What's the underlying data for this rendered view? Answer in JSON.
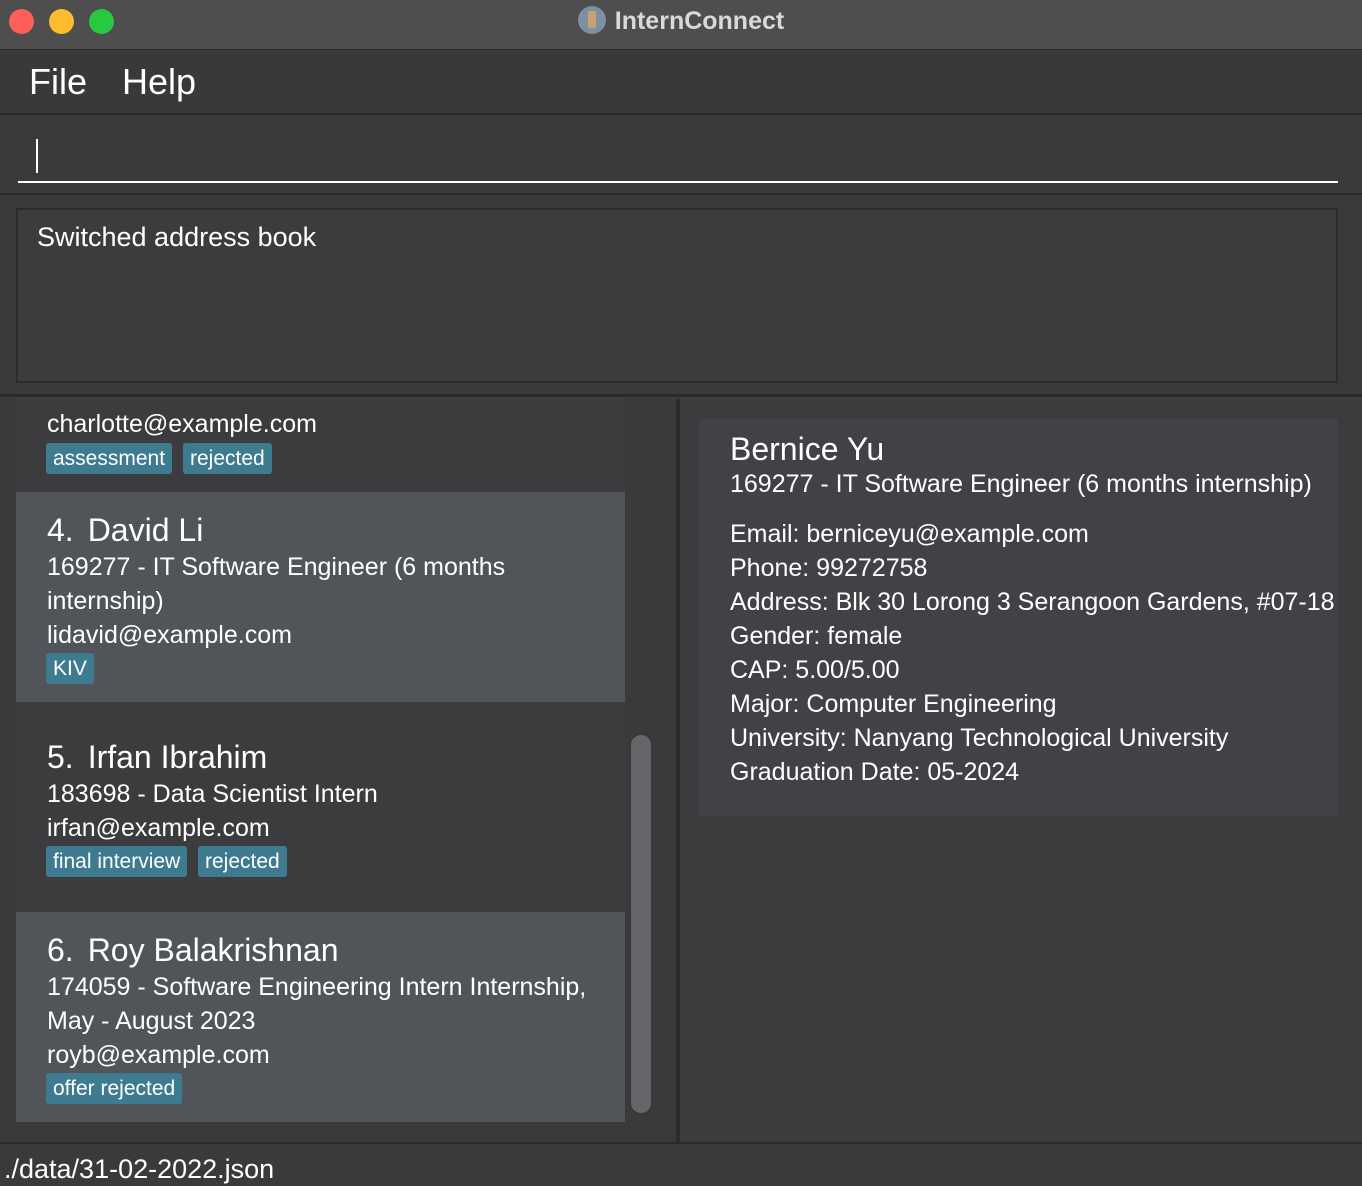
{
  "window": {
    "title": "InternConnect"
  },
  "menu": {
    "file": "File",
    "help": "Help"
  },
  "command": {
    "value": "",
    "placeholder": ""
  },
  "result": {
    "message": "Switched address book"
  },
  "list": {
    "partial_card": {
      "email": "charlotte@example.com",
      "tags": [
        "assessment",
        "rejected"
      ]
    },
    "cards": [
      {
        "index": "4.",
        "name": "David Li",
        "job_line1": "169277 - IT Software Engineer (6 months",
        "job_line2": "internship)",
        "email": "lidavid@example.com",
        "tags": [
          "KIV"
        ]
      },
      {
        "index": "5.",
        "name": "Irfan Ibrahim",
        "job_line1": "183698 - Data Scientist Intern",
        "email": "irfan@example.com",
        "tags": [
          "final interview",
          "rejected"
        ]
      },
      {
        "index": "6.",
        "name": "Roy Balakrishnan",
        "job_line1": "174059 - Software Engineering Intern Internship,",
        "job_line2": "May - August 2023",
        "email": "royb@example.com",
        "tags": [
          "offer rejected"
        ]
      }
    ]
  },
  "detail": {
    "name": "Bernice Yu",
    "job": "169277 - IT Software Engineer (6 months internship)",
    "email": "Email: berniceyu@example.com",
    "phone": "Phone: 99272758",
    "address": "Address: Blk 30 Lorong 3 Serangoon Gardens, #07-18",
    "gender": "Gender: female",
    "cap": "CAP: 5.00/5.00",
    "major": "Major: Computer Engineering",
    "university": "University: Nanyang Technological University",
    "graduation": "Graduation Date: 05-2024"
  },
  "status": {
    "path": "./data/31-02-2022.json"
  },
  "colors": {
    "tag": "#3e7b91",
    "selected_card": "#515559",
    "close": "#fe5f57",
    "minimize": "#febc2e",
    "maximize": "#28c840"
  },
  "icons": [
    "close-icon",
    "minimize-icon",
    "maximize-icon",
    "app-icon"
  ]
}
